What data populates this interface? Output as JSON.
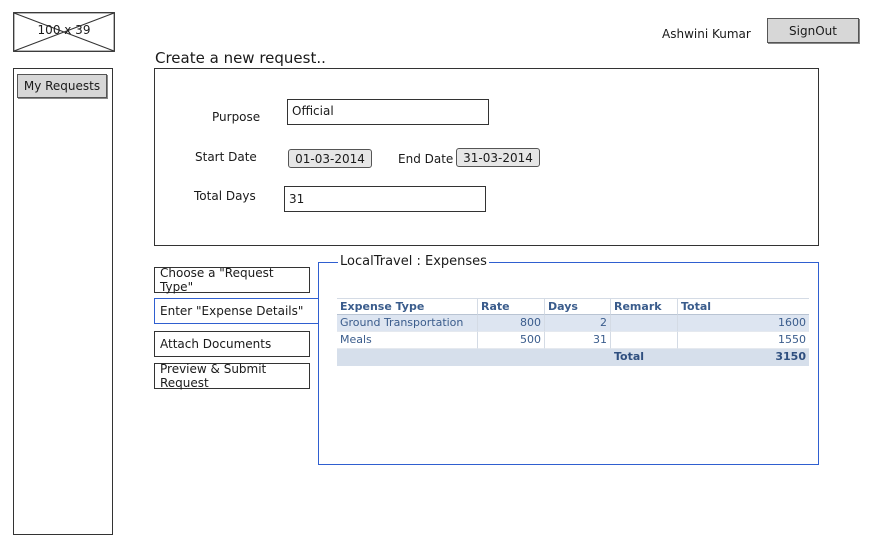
{
  "header": {
    "logo_placeholder": "100 x 39",
    "user_name": "Ashwini Kumar",
    "signout_label": "SignOut"
  },
  "sidebar": {
    "items": [
      {
        "label": "My Requests"
      }
    ]
  },
  "form": {
    "title": "Create a new request..",
    "purpose_label": "Purpose",
    "purpose_value": "Official",
    "start_date_label": "Start Date",
    "start_date_value": "01-03-2014",
    "end_date_label": "End Date",
    "end_date_value": "31-03-2014",
    "total_days_label": "Total Days",
    "total_days_value": "31"
  },
  "steps": [
    {
      "label": "Choose a \"Request Type\"",
      "active": false
    },
    {
      "label": "Enter \"Expense Details\"",
      "active": true
    },
    {
      "label": "Attach Documents",
      "active": false
    },
    {
      "label": "Preview & Submit Request",
      "active": false
    }
  ],
  "expenses": {
    "title": "LocalTravel : Expenses",
    "columns": [
      "Expense Type",
      "Rate",
      "Days",
      "Remark",
      "Total"
    ],
    "rows": [
      [
        "Ground Transportation",
        "800",
        "2",
        "",
        "1600"
      ],
      [
        "Meals",
        "500",
        "31",
        "",
        "1550"
      ]
    ],
    "footer_label": "Total",
    "footer_total": "3150"
  },
  "colors": {
    "accent": "#2f5fd0",
    "button_bg": "#d7d7d7",
    "table_header_text": "#3a5c8c",
    "table_footer_bg": "#d6dfeb"
  }
}
